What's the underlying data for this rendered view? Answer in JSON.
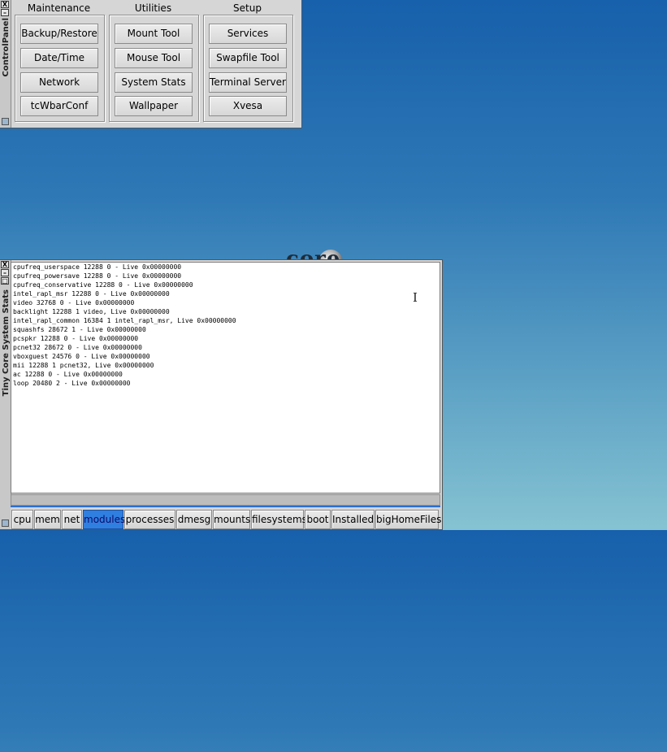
{
  "control_panel": {
    "title": "ControlPanel",
    "columns": [
      {
        "header": "Maintenance",
        "buttons": [
          "Backup/Restore",
          "Date/Time",
          "Network",
          "tcWbarConf"
        ]
      },
      {
        "header": "Utilities",
        "buttons": [
          "Mount Tool",
          "Mouse Tool",
          "System Stats",
          "Wallpaper"
        ]
      },
      {
        "header": "Setup",
        "buttons": [
          "Services",
          "Swapfile Tool",
          "Terminal Server",
          "Xvesa"
        ]
      }
    ]
  },
  "stats_window": {
    "title": "Tiny Core System Stats",
    "lines": [
      "cpufreq_userspace 12288 0 - Live 0x00000000",
      "cpufreq_powersave 12288 0 - Live 0x00000000",
      "cpufreq_conservative 12288 0 - Live 0x00000000",
      "intel_rapl_msr 12288 0 - Live 0x00000000",
      "video 32768 0 - Live 0x00000000",
      "backlight 12288 1 video, Live 0x00000000",
      "intel_rapl_common 16384 1 intel_rapl_msr, Live 0x00000000",
      "squashfs 28672 1 - Live 0x00000000",
      "pcspkr 12288 0 - Live 0x00000000",
      "pcnet32 28672 0 - Live 0x00000000",
      "vboxguest 24576 0 - Live 0x00000000",
      "mii 12288 1 pcnet32, Live 0x00000000",
      "ac 12288 0 - Live 0x00000000",
      "loop 20480 2 - Live 0x00000000"
    ],
    "tabs": [
      "cpu",
      "mem",
      "net",
      "modules",
      "processes",
      "dmesg",
      "mounts",
      "filesystems",
      "boot",
      "Installed",
      "bigHomeFiles"
    ],
    "active_tab": "modules"
  },
  "window_buttons": {
    "close": "X",
    "minimize": "–",
    "maximize": "□"
  },
  "desktop": {
    "logo_text": "core"
  },
  "colors": {
    "desktop_top": "#1760ab",
    "desktop_bottom": "#86c3d2",
    "active_tab": "#2f7fe0",
    "tab_bar_line": "#2c6fd0"
  }
}
